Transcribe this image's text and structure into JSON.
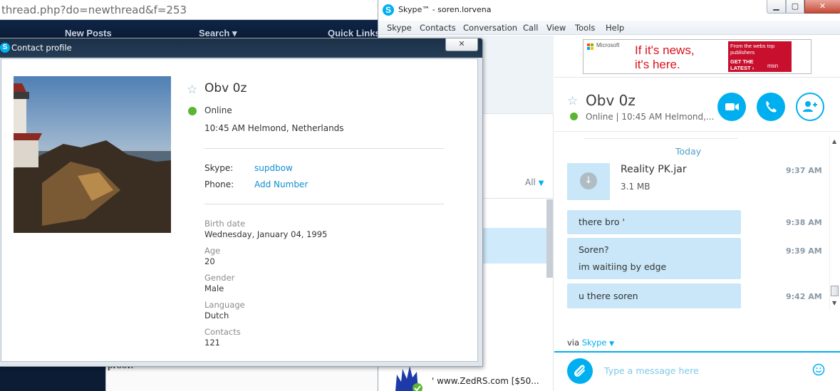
{
  "browser": {
    "address": "thread.php?do=newthread&f=253",
    "nav": [
      "New Posts",
      "Search",
      "Quick Links"
    ],
    "post_fragment": "proof."
  },
  "skype": {
    "title": "Skype™ - soren.lorvena",
    "window_buttons": {
      "minimize": "▁",
      "maximize": "▢",
      "close": "✕"
    },
    "menu": [
      "Skype",
      "Contacts",
      "Conversation",
      "Call",
      "View",
      "Tools",
      "Help"
    ],
    "contacts_filter": "All",
    "recent_contact": "' www.ZedRS.com [$50...",
    "ad": {
      "brand": "Microsoft",
      "line1": "If it's news,",
      "line2": "it's here.",
      "side_text": "From the webs top publishers",
      "cta": "GET THE LATEST ›",
      "partner": "msn"
    },
    "conversation": {
      "contact_name": "Obv 0z",
      "status_line": "Online | 10:45 AM Helmond,...",
      "date_divider": "Today",
      "file": {
        "name": "Reality PK.jar",
        "size": "3.1 MB",
        "time": "9:37 AM"
      },
      "messages": [
        {
          "lines": [
            "there bro '"
          ],
          "time": "9:38 AM"
        },
        {
          "lines": [
            "Soren?",
            "im waitiing by edge"
          ],
          "time": "9:39 AM"
        },
        {
          "lines": [
            "u there soren"
          ],
          "time": "9:42 AM"
        }
      ],
      "via_prefix": "via ",
      "via_link": "Skype",
      "input_placeholder": "Type a message here"
    }
  },
  "profile": {
    "window_title": "Contact profile",
    "close_glyph": "✕",
    "name": "Obv 0z",
    "status": "Online",
    "local_time": "10:45 AM Helmond, Netherlands",
    "skype_label": "Skype:",
    "skype_value": "supdbow",
    "phone_label": "Phone:",
    "phone_value": "Add Number",
    "fields": [
      {
        "label": "Birth date",
        "value": "Wednesday, January 04, 1995"
      },
      {
        "label": "Age",
        "value": "20"
      },
      {
        "label": "Gender",
        "value": "Male"
      },
      {
        "label": "Language",
        "value": "Dutch"
      },
      {
        "label": "Contacts",
        "value": "121"
      }
    ]
  },
  "colors": {
    "skype_blue": "#00aff0",
    "online_green": "#5bb533",
    "bubble_blue": "#c9e7f8",
    "ad_red": "#c8102e"
  },
  "icons": {
    "favorite": "star-outline-icon",
    "online": "online-status-icon",
    "video_call": "video-camera-icon",
    "audio_call": "phone-icon",
    "add_people": "add-person-icon",
    "attach": "paperclip-icon",
    "emoji": "smiley-icon",
    "download": "download-icon"
  }
}
